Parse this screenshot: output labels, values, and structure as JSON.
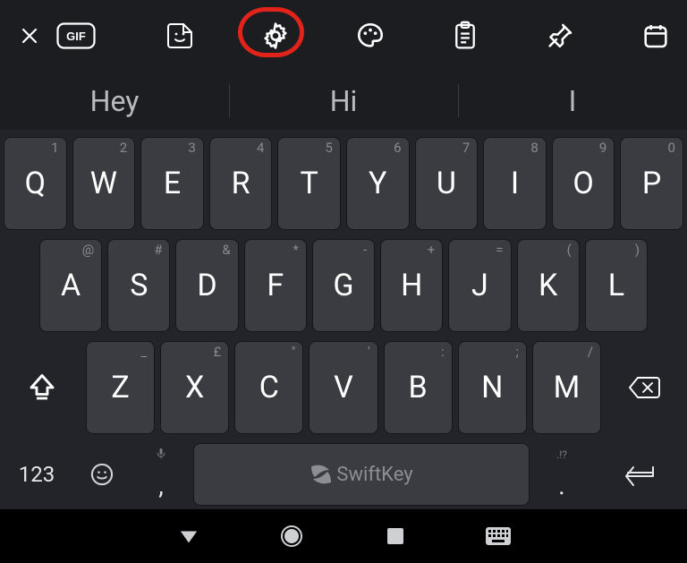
{
  "toolbar": {
    "close_icon": "close",
    "gif_label": "GIF",
    "sticker_icon": "sticker",
    "settings_icon": "settings",
    "themes_icon": "palette",
    "clipboard_icon": "clipboard",
    "pin_icon": "pin",
    "calendar_icon": "calendar"
  },
  "highlight": {
    "target": "settings-button"
  },
  "suggestions": [
    "Hey",
    "Hi",
    "I"
  ],
  "keyboard": {
    "row1": [
      {
        "main": "Q",
        "sub": "1"
      },
      {
        "main": "W",
        "sub": "2"
      },
      {
        "main": "E",
        "sub": "3"
      },
      {
        "main": "R",
        "sub": "4"
      },
      {
        "main": "T",
        "sub": "5"
      },
      {
        "main": "Y",
        "sub": "6"
      },
      {
        "main": "U",
        "sub": "7"
      },
      {
        "main": "I",
        "sub": "8"
      },
      {
        "main": "O",
        "sub": "9"
      },
      {
        "main": "P",
        "sub": "0"
      }
    ],
    "row2": [
      {
        "main": "A",
        "sub": "@"
      },
      {
        "main": "S",
        "sub": "#"
      },
      {
        "main": "D",
        "sub": "&"
      },
      {
        "main": "F",
        "sub": "*"
      },
      {
        "main": "G",
        "sub": "-"
      },
      {
        "main": "H",
        "sub": "+"
      },
      {
        "main": "J",
        "sub": "="
      },
      {
        "main": "K",
        "sub": "("
      },
      {
        "main": "L",
        "sub": ")"
      }
    ],
    "row3": [
      {
        "main": "Z",
        "sub": "_"
      },
      {
        "main": "X",
        "sub": "£"
      },
      {
        "main": "C",
        "sub": "\""
      },
      {
        "main": "V",
        "sub": "'"
      },
      {
        "main": "B",
        "sub": ":"
      },
      {
        "main": "N",
        "sub": ";"
      },
      {
        "main": "M",
        "sub": "/"
      }
    ],
    "shift_icon": "shift",
    "backspace_icon": "backspace",
    "numbers_label": "123",
    "emoji_icon": "emoji",
    "mic_icon": "mic",
    "comma_label": ",",
    "space_label": "SwiftKey",
    "period_label": ".",
    "punct_sub": ".!?",
    "enter_icon": "enter"
  },
  "navbar": {
    "back_icon": "back",
    "home_icon": "home",
    "recents_icon": "recents",
    "keyboard_icon": "keyboard-toggle"
  }
}
